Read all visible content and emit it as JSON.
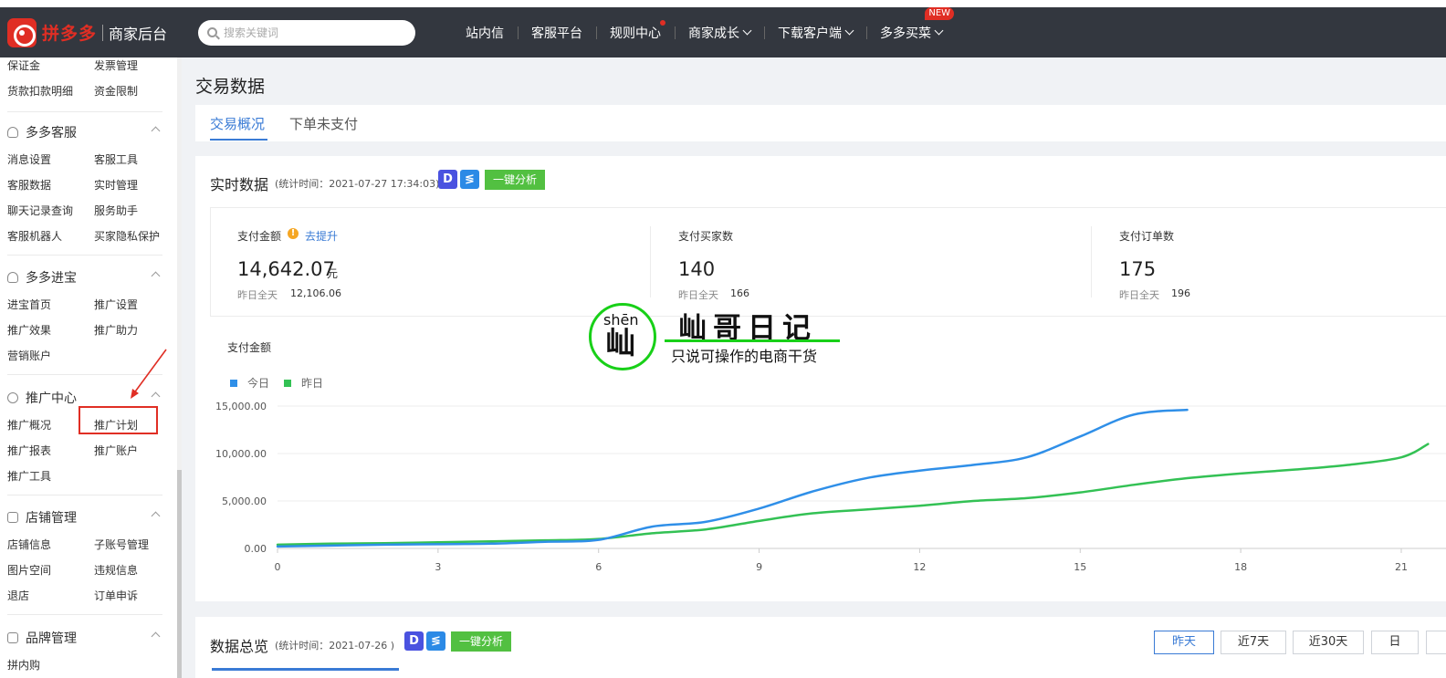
{
  "header": {
    "logo_text": "拼多多",
    "logo_sub": "商家后台",
    "search_placeholder": "搜索关键词",
    "nav": [
      {
        "label": "站内信"
      },
      {
        "label": "客服平台"
      },
      {
        "label": "规则中心"
      },
      {
        "label": "商家成长"
      },
      {
        "label": "下载客户端"
      },
      {
        "label": "多多买菜"
      }
    ],
    "new_badge": "NEW"
  },
  "sidebar": {
    "top_items": [
      "保证金",
      "发票管理",
      "货款扣款明细",
      "资金限制"
    ],
    "groups": [
      {
        "title": "多多客服",
        "items": [
          "消息设置",
          "客服工具",
          "客服数据",
          "实时管理",
          "聊天记录查询",
          "服务助手",
          "客服机器人",
          "买家隐私保护"
        ]
      },
      {
        "title": "多多进宝",
        "items": [
          "进宝首页",
          "推广设置",
          "推广效果",
          "推广助力",
          "营销账户"
        ]
      },
      {
        "title": "推广中心",
        "items": [
          "推广概况",
          "推广计划",
          "推广报表",
          "推广账户",
          "推广工具"
        ]
      },
      {
        "title": "店铺管理",
        "items": [
          "店铺信息",
          "子账号管理",
          "图片空间",
          "违规信息",
          "退店",
          "订单申诉"
        ]
      },
      {
        "title": "品牌管理",
        "items": [
          "拼内购"
        ]
      }
    ]
  },
  "page": {
    "title": "交易数据",
    "tabs": [
      "交易概况",
      "下单未支付"
    ]
  },
  "realtime": {
    "title": "实时数据",
    "time": "(统计时间：2021-07-27 17:34:03)",
    "analyze_label": "一键分析",
    "kpis": [
      {
        "label": "支付金额",
        "link": "去提升",
        "value": "14,642.07",
        "unit": "元",
        "sub_label": "昨日全天",
        "sub_value": "12,106.06"
      },
      {
        "label": "支付买家数",
        "value": "140",
        "sub_label": "昨日全天",
        "sub_value": "166"
      },
      {
        "label": "支付订单数",
        "value": "175",
        "sub_label": "昨日全天",
        "sub_value": "196"
      }
    ],
    "chart_title": "支付金额"
  },
  "overview": {
    "title": "数据总览",
    "time": "(统计时间：2021-07-26 )",
    "analyze_label": "一键分析",
    "ranges": [
      "昨天",
      "近7天",
      "近30天",
      "日"
    ]
  },
  "watermark": {
    "pinyin": "shēn",
    "char": "屾",
    "title": "屾哥日记",
    "subtitle": "只说可操作的电商干货"
  },
  "colors": {
    "today": "#2f8fe8",
    "yesterday": "#33c154",
    "accent": "#3a7bd5"
  },
  "chart_data": {
    "type": "line",
    "x_ticks": [
      "0",
      "3",
      "6",
      "9",
      "12",
      "15",
      "18",
      "21"
    ],
    "y_ticks": [
      "0.00",
      "5,000.00",
      "10,000.00",
      "15,000.00"
    ],
    "ylim": [
      0,
      15000
    ],
    "xlim": [
      0,
      21.5
    ],
    "legend": [
      "今日",
      "昨日"
    ],
    "series": [
      {
        "name": "今日",
        "color": "#2f8fe8",
        "x": [
          0,
          1,
          2,
          3,
          4,
          5,
          6,
          7,
          8,
          9,
          10,
          11,
          12,
          13,
          14,
          15,
          16,
          17
        ],
        "values": [
          200,
          300,
          400,
          450,
          500,
          700,
          900,
          2300,
          2800,
          4200,
          6000,
          7400,
          8200,
          8800,
          9600,
          11800,
          14100,
          14600
        ]
      },
      {
        "name": "昨日",
        "color": "#33c154",
        "x": [
          0,
          1,
          2,
          3,
          4,
          5,
          6,
          7,
          8,
          9,
          10,
          11,
          12,
          13,
          14,
          15,
          16,
          17,
          18,
          19,
          20,
          21,
          21.5
        ],
        "values": [
          400,
          500,
          550,
          650,
          750,
          850,
          1000,
          1600,
          2000,
          2900,
          3700,
          4100,
          4500,
          5000,
          5300,
          5900,
          6700,
          7400,
          7900,
          8300,
          8800,
          9600,
          11000
        ]
      }
    ]
  }
}
